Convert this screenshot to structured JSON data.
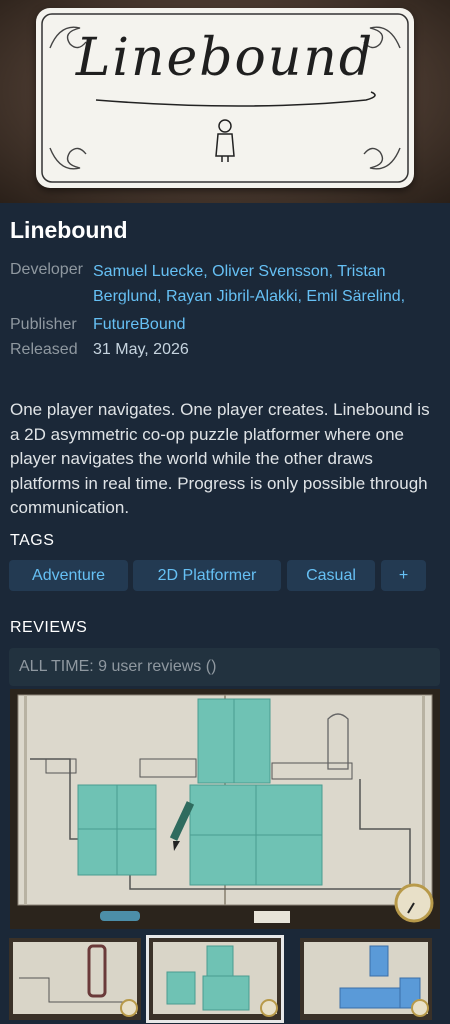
{
  "game": {
    "title": "Linebound",
    "logo_text": "Linebound"
  },
  "meta": {
    "developer_label": "Developer",
    "developers": "Samuel Luecke, Oliver Svensson, Tristan Berglund, Rayan Jibril-Alakki, Emil Särelind,",
    "publisher_label": "Publisher",
    "publisher": "FutureBound",
    "released_label": "Released",
    "release_date": "31 May, 2026"
  },
  "description": "One player navigates. One player creates. Linebound is a 2D asymmetric co-op puzzle platformer where one player navigates the world while the other draws platforms in real time. Progress is only possible through communication.",
  "tags": {
    "heading": "TAGS",
    "items": [
      "Adventure",
      "2D Platformer",
      "Casual",
      "+"
    ]
  },
  "reviews": {
    "heading": "REVIEWS",
    "summary": "ALL TIME: 9 user reviews ()"
  },
  "colors": {
    "background": "#1b2838",
    "link": "#66c0f4",
    "tag_bg": "#233a52",
    "water_tile": "#6fc2b4"
  },
  "icons": {
    "pencil": "pencil-icon",
    "clock": "clock-icon"
  }
}
